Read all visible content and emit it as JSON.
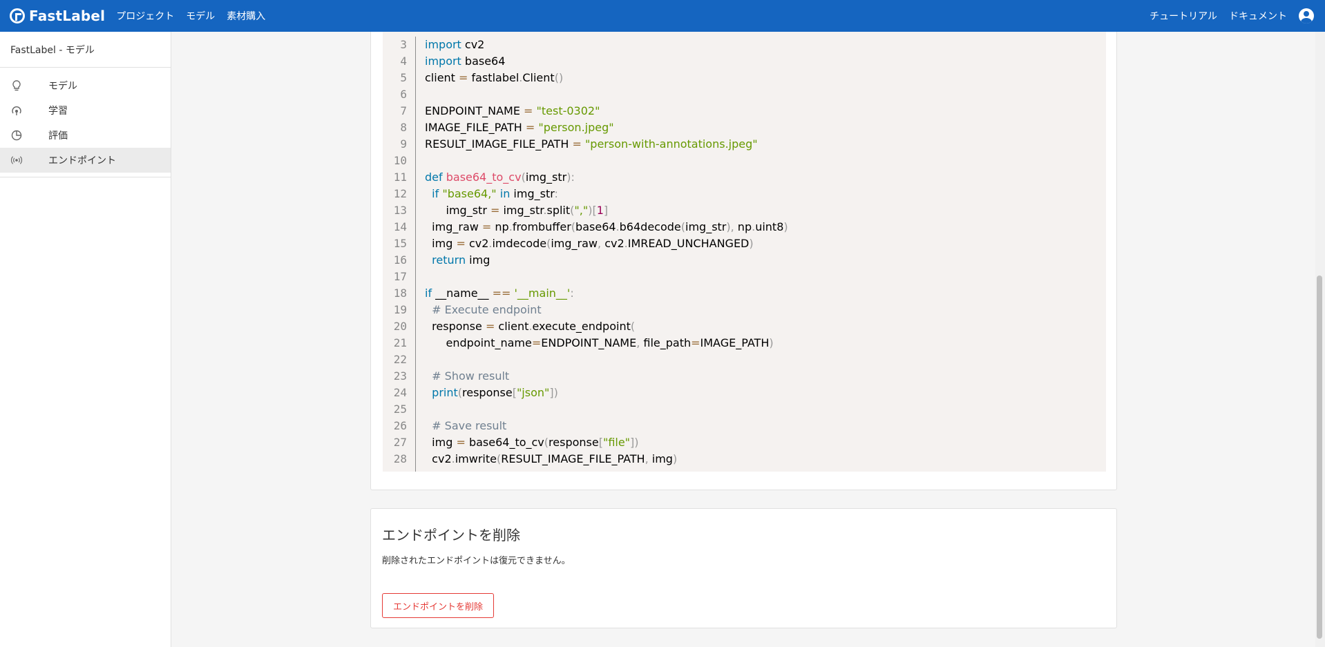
{
  "header": {
    "logo_text": "FastLabel",
    "nav": [
      "プロジェクト",
      "モデル",
      "素材購入"
    ],
    "right_links": [
      "チュートリアル",
      "ドキュメント"
    ],
    "account_icon": "account-circle-icon",
    "colors": {
      "bar": "#1565c0"
    }
  },
  "sidebar": {
    "title": "FastLabel - モデル",
    "items": [
      {
        "label": "モデル",
        "icon": "lightbulb-icon"
      },
      {
        "label": "学習",
        "icon": "training-icon"
      },
      {
        "label": "評価",
        "icon": "chart-pie-icon"
      },
      {
        "label": "エンドポイント",
        "icon": "broadcast-icon",
        "active": true
      }
    ]
  },
  "code": {
    "line_numbers": [
      "3",
      "4",
      "5",
      "6",
      "7",
      "8",
      "9",
      "10",
      "11",
      "12",
      "13",
      "14",
      "15",
      "16",
      "17",
      "18",
      "19",
      "20",
      "21",
      "22",
      "23",
      "24",
      "25",
      "26",
      "27",
      "28"
    ],
    "lines": [
      "import cv2",
      "import base64",
      "client = fastlabel.Client()",
      "",
      "ENDPOINT_NAME = \"test-0302\"",
      "IMAGE_FILE_PATH = \"person.jpeg\"",
      "RESULT_IMAGE_FILE_PATH = \"person-with-annotations.jpeg\"",
      "",
      "def base64_to_cv(img_str):",
      "  if \"base64,\" in img_str:",
      "      img_str = img_str.split(\",\")[1]",
      "  img_raw = np.frombuffer(base64.b64decode(img_str), np.uint8)",
      "  img = cv2.imdecode(img_raw, cv2.IMREAD_UNCHANGED)",
      "  return img",
      "",
      "if __name__ == '__main__':",
      "  # Execute endpoint",
      "  response = client.execute_endpoint(",
      "      endpoint_name=ENDPOINT_NAME, file_path=IMAGE_PATH)",
      "",
      "  # Show result",
      "  print(response[\"json\"])",
      "",
      "  # Save result",
      "  img = base64_to_cv(response[\"file\"])",
      "  cv2.imwrite(RESULT_IMAGE_FILE_PATH, img)"
    ]
  },
  "delete_section": {
    "title": "エンドポイントを削除",
    "description": "削除されたエンドポイントは復元できません。",
    "button_label": "エンドポイントを削除",
    "button_color": "#e53935"
  }
}
